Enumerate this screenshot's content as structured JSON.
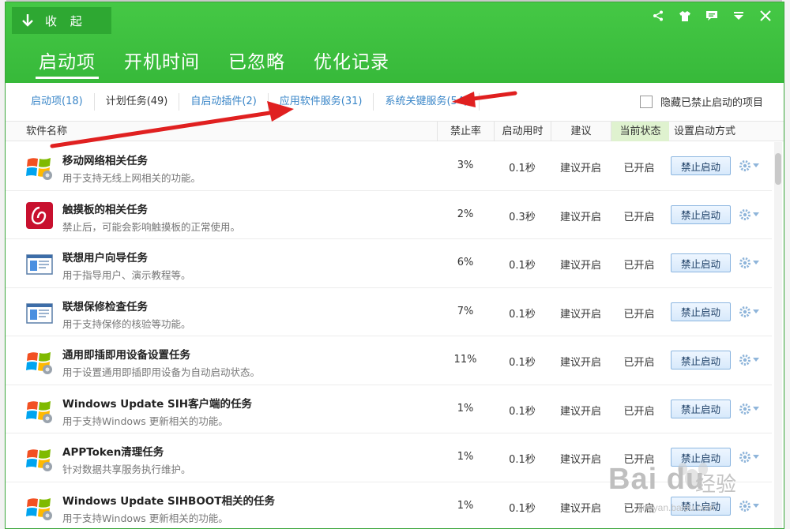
{
  "header": {
    "collapse_label": "收 起",
    "tabs": [
      {
        "label": "启动项",
        "active": true
      },
      {
        "label": "开机时间",
        "active": false
      },
      {
        "label": "已忽略",
        "active": false
      },
      {
        "label": "优化记录",
        "active": false
      }
    ],
    "window_controls": [
      "share-icon",
      "shirt-icon",
      "message-icon",
      "menu-icon",
      "close-icon"
    ]
  },
  "subtabs": [
    {
      "label": "启动项(18)",
      "style": "link"
    },
    {
      "label": "计划任务(49)",
      "style": "plain"
    },
    {
      "label": "自启动插件(2)",
      "style": "link"
    },
    {
      "label": "应用软件服务(31)",
      "style": "link"
    },
    {
      "label": "系统关键服务(54)",
      "style": "link"
    }
  ],
  "hide_option": {
    "label": "隐藏已禁止启动的项目",
    "checked": false
  },
  "columns": {
    "name": "软件名称",
    "rate": "禁止率",
    "time": "启动用时",
    "suggest": "建议",
    "state": "当前状态",
    "action": "设置启动方式"
  },
  "rows": [
    {
      "title": "移动网络相关任务",
      "desc": "用于支持无线上网相关的功能。",
      "rate": "3%",
      "time": "0.1秒",
      "suggest": "建议开启",
      "state": "已开启",
      "action": "禁止启动",
      "icon": "windows-flag-icon"
    },
    {
      "title": "触摸板的相关任务",
      "desc": "禁止后，可能会影响触摸板的正常使用。",
      "rate": "2%",
      "time": "0.3秒",
      "suggest": "建议开启",
      "state": "已开启",
      "action": "禁止启动",
      "icon": "touchpad-icon"
    },
    {
      "title": "联想用户向导任务",
      "desc": "用于指导用户、演示教程等。",
      "rate": "6%",
      "time": "0.1秒",
      "suggest": "建议开启",
      "state": "已开启",
      "action": "禁止启动",
      "icon": "window-app-icon"
    },
    {
      "title": "联想保修检查任务",
      "desc": "用于支持保修的核验等功能。",
      "rate": "7%",
      "time": "0.1秒",
      "suggest": "建议开启",
      "state": "已开启",
      "action": "禁止启动",
      "icon": "window-app-icon"
    },
    {
      "title": "通用即插即用设备设置任务",
      "desc": "用于设置通用即插即用设备为自动启动状态。",
      "rate": "11%",
      "time": "0.1秒",
      "suggest": "建议开启",
      "state": "已开启",
      "action": "禁止启动",
      "icon": "windows-flag-icon"
    },
    {
      "title": "Windows Update SIH客户端的任务",
      "desc": "用于支持Windows 更新相关的功能。",
      "rate": "1%",
      "time": "0.1秒",
      "suggest": "建议开启",
      "state": "已开启",
      "action": "禁止启动",
      "icon": "windows-flag-icon"
    },
    {
      "title": "APPToken清理任务",
      "desc": "针对数据共享服务执行维护。",
      "rate": "1%",
      "time": "0.1秒",
      "suggest": "建议开启",
      "state": "已开启",
      "action": "禁止启动",
      "icon": "windows-flag-icon"
    },
    {
      "title": "Windows Update SIHBOOT相关的任务",
      "desc": "用于支持Windows 更新相关的功能。",
      "rate": "1%",
      "time": "0.1秒",
      "suggest": "建议开启",
      "state": "已开启",
      "action": "禁止启动",
      "icon": "windows-flag-icon"
    }
  ],
  "watermark": {
    "brand": "Bai du",
    "sub": "经验",
    "url": "jingyan.baidu.com"
  },
  "colors": {
    "header_green": "#37b93a",
    "link_blue": "#3a86c8",
    "arrow_red": "#e02020",
    "state_col_bg": "#dff2cf"
  }
}
